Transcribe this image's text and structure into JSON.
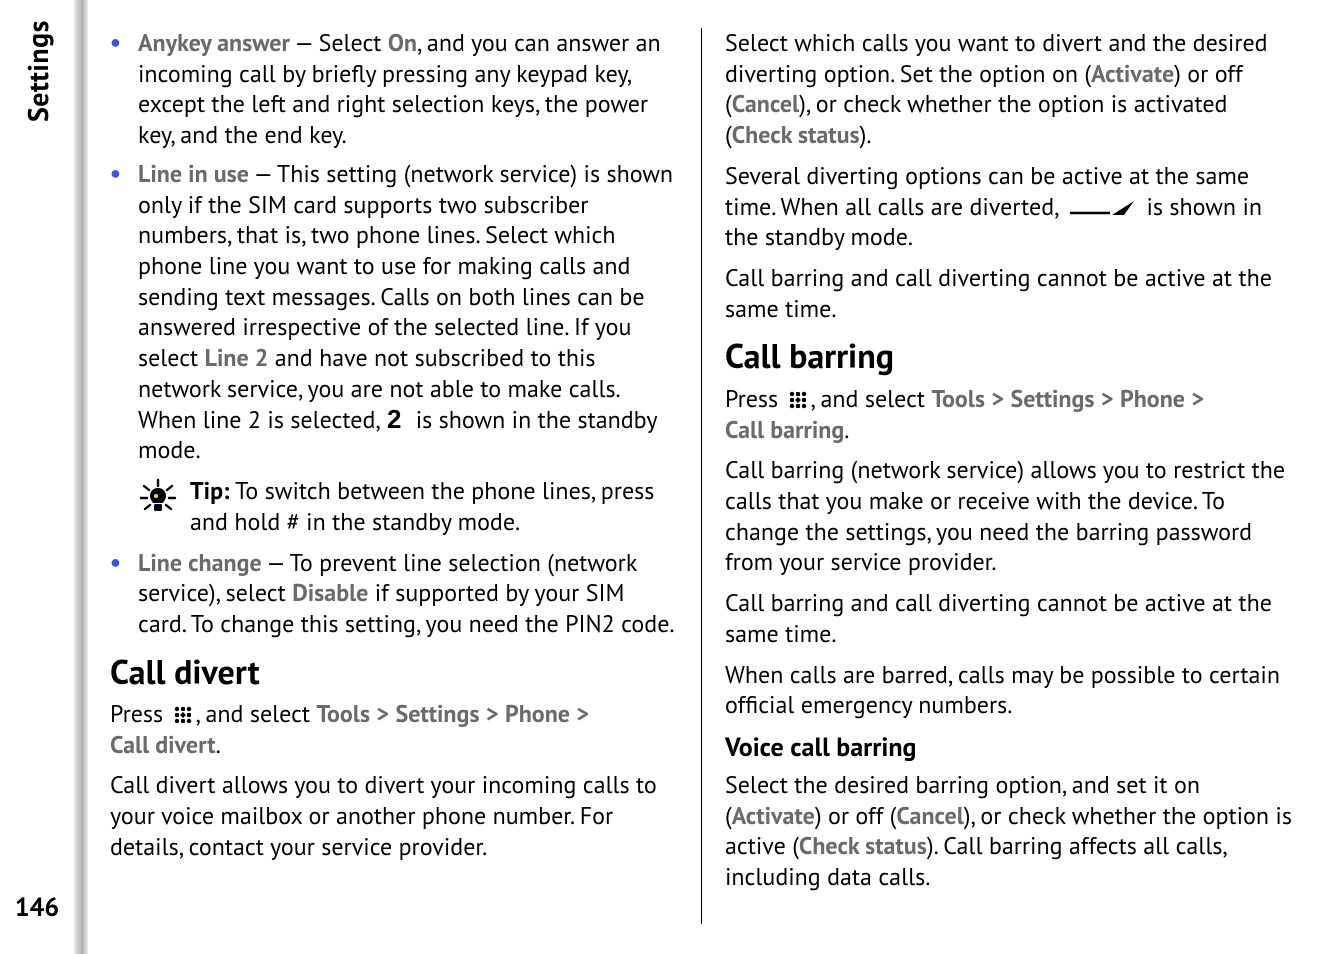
{
  "sidebar": {
    "title": "Settings",
    "page_number": "146"
  },
  "bullets": {
    "anykey": {
      "term": "Anykey answer",
      "on_label": "On",
      "before": " — Select ",
      "after": ", and you can answer an incoming call by briefly pressing any keypad key, except the left and right selection keys, the power key, and the end key."
    },
    "lineinuse": {
      "term": "Line in use",
      "line2_label": "Line 2",
      "t1": " — This setting (network service) is shown only if the SIM card supports two subscriber numbers, that is, two phone lines. Select which phone line you want to use for making calls and sending text messages. Calls on both lines can be answered irrespective of the selected line. If you select ",
      "t2": " and have not subscribed to this network service, you are not able to make calls. When line 2 is selected, ",
      "t3": " is shown in the standby mode."
    },
    "linechange": {
      "term": "Line change",
      "disable_label": "Disable",
      "t1": " — To prevent line selection (network service), select ",
      "t2": " if supported by your SIM card. To change this setting, you need the PIN2 code."
    }
  },
  "tip": {
    "label": "Tip:",
    "text": " To switch between the phone lines, press and hold # in the standby mode."
  },
  "calldivert": {
    "heading": "Call divert",
    "nav": {
      "press": "Press ",
      "and_select": ", and select ",
      "tools": "Tools",
      "settings": "Settings",
      "phone": "Phone",
      "calldivert": "Call divert",
      "gt": ">",
      "end": "."
    },
    "p1": "Call divert allows you to divert your incoming calls to your voice mailbox or another phone number. For details, contact your service provider.",
    "p2a": "Select which calls you want to divert and the desired diverting option. Set the option on (",
    "activate": "Activate",
    "p2b": ") or off (",
    "cancel": "Cancel",
    "p2c": "), or check whether the option is activated (",
    "checkstatus": "Check status",
    "p2d": ").",
    "p3a": "Several diverting options can be active at the same time. When all calls are diverted, ",
    "p3b": " is shown in the standby mode.",
    "p4": "Call barring and call diverting cannot be active at the same time."
  },
  "callbarring": {
    "heading": "Call barring",
    "nav": {
      "press": "Press ",
      "and_select": ", and select ",
      "tools": "Tools",
      "settings": "Settings",
      "phone": "Phone",
      "callbarring": "Call barring",
      "gt": ">",
      "end": "."
    },
    "p1": "Call barring (network service) allows you to restrict the calls that you make or receive with the device. To change the settings, you need the barring password from your service provider.",
    "p2": "Call barring and call diverting cannot be active at the same time.",
    "p3": "When calls are barred, calls may be possible to certain official emergency numbers.",
    "voice_heading": "Voice call barring",
    "voice_a": "Select the desired barring option, and set it on (",
    "activate": "Activate",
    "voice_b": ") or off (",
    "cancel": "Cancel",
    "voice_c": "), or check whether the option is active (",
    "checkstatus": "Check status",
    "voice_d": "). Call barring affects all calls, including data calls."
  }
}
